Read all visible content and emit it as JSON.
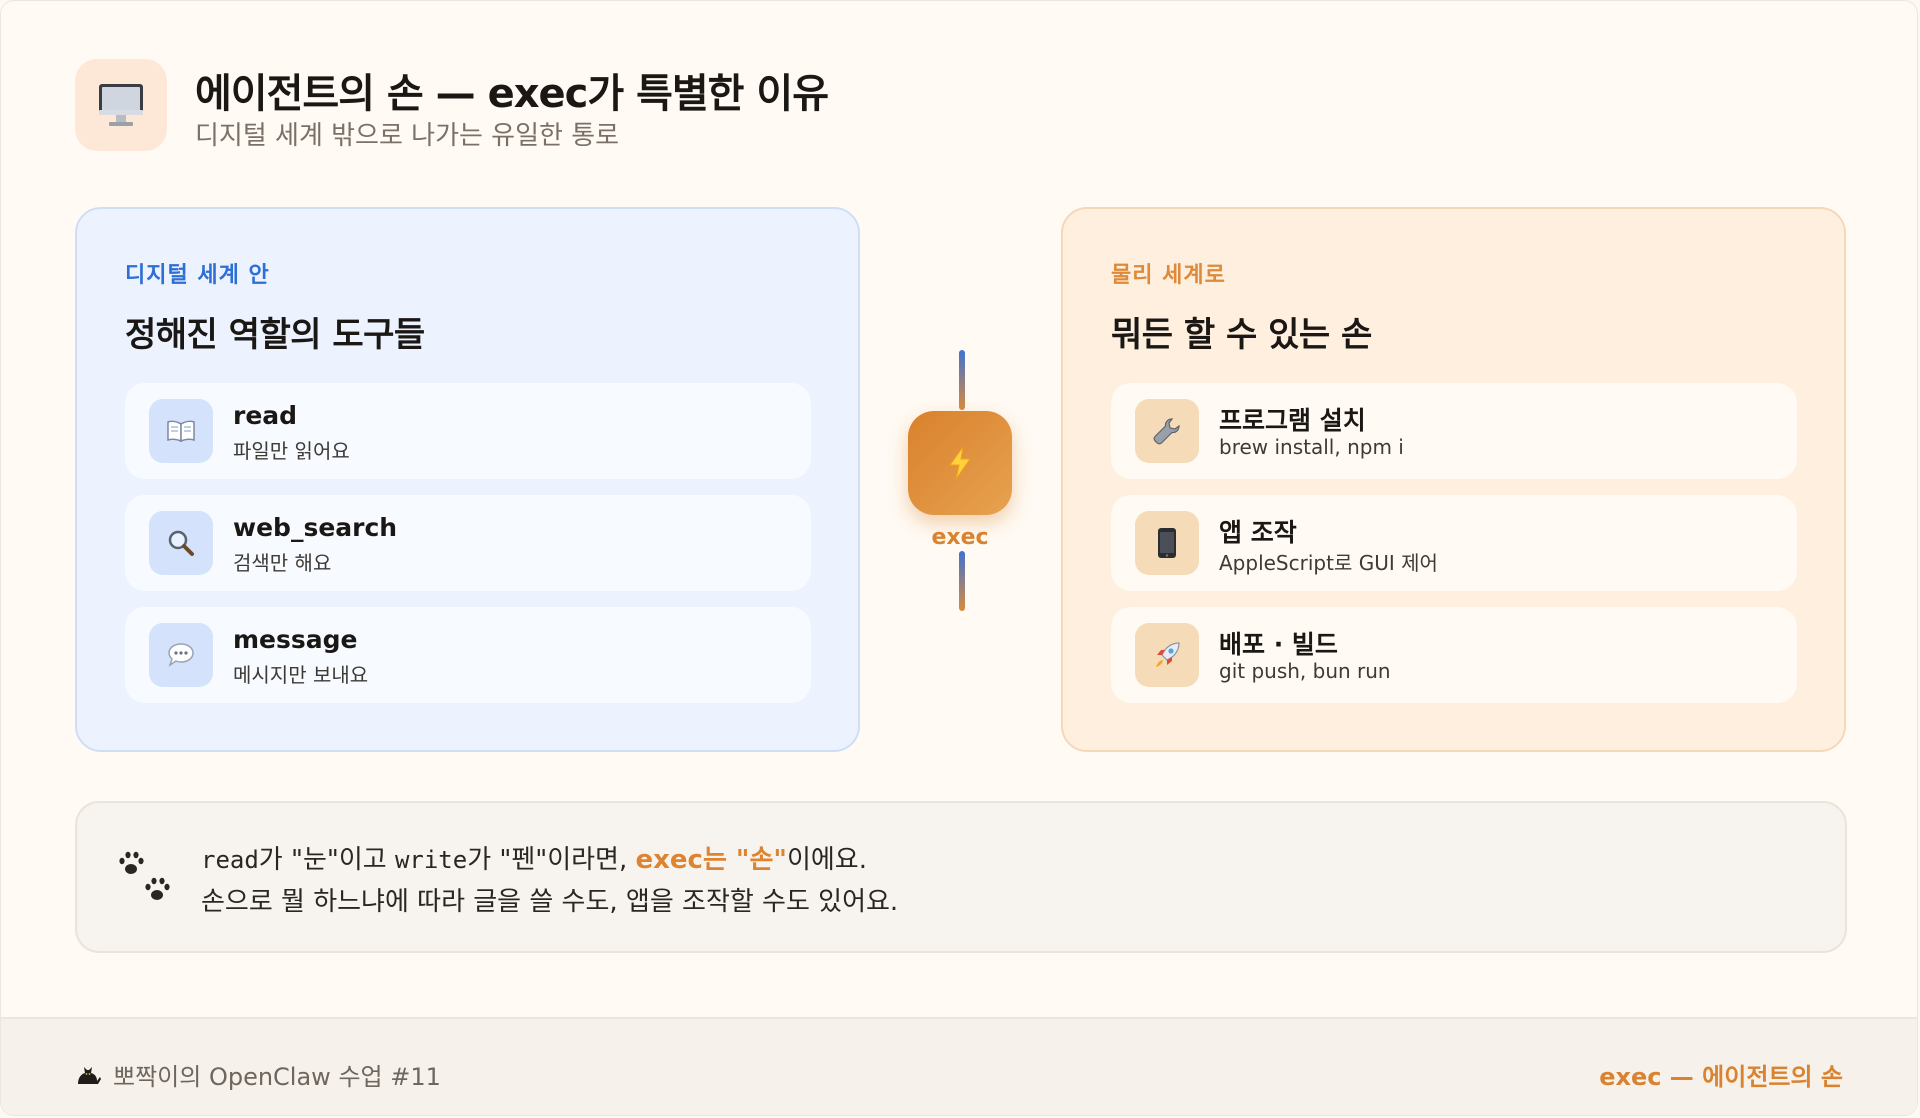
{
  "header": {
    "title": "에이전트의 손 — exec가 특별한 이유",
    "subtitle": "디지털 세계 밖으로 나가는 유일한 통로",
    "icon": "desktop-computer-icon"
  },
  "left_panel": {
    "kicker": "디지털 세계 안",
    "heading": "정해진 역할의 도구들",
    "items": [
      {
        "icon": "open-book-icon",
        "title": "read",
        "desc": "파일만 읽어요"
      },
      {
        "icon": "magnifier-icon",
        "title": "web_search",
        "desc": "검색만 해요"
      },
      {
        "icon": "speech-bubble-icon",
        "title": "message",
        "desc": "메시지만 보내요"
      }
    ]
  },
  "connector": {
    "icon": "lightning-bolt-icon",
    "label": "exec"
  },
  "right_panel": {
    "kicker": "물리 세계로",
    "heading": "뭐든 할 수 있는 손",
    "items": [
      {
        "icon": "wrench-icon",
        "title": "프로그램 설치",
        "desc": "brew install, npm i"
      },
      {
        "icon": "mobile-phone-icon",
        "title": "앱 조작",
        "desc": "AppleScript로 GUI 제어"
      },
      {
        "icon": "rocket-icon",
        "title": "배포 · 빌드",
        "desc": "git push, bun run"
      }
    ]
  },
  "note": {
    "icon": "paw-prints-icon",
    "line1": {
      "code1": "read",
      "text1": "가 \"눈\"이고 ",
      "code2": "write",
      "text2": "가 \"펜\"이라면, ",
      "highlight": "exec는 \"손\"",
      "text3": "이에요."
    },
    "line2": "손으로 뭘 하느냐에 따라 글을 쓸 수도, 앱을 조작할 수도 있어요."
  },
  "footer": {
    "icon": "black-cat-icon",
    "left_text": "뽀짝이의 OpenClaw 수업 #11",
    "right_text": "exec — 에이전트의 손"
  },
  "colors": {
    "accent_orange": "#de8431",
    "accent_blue": "#2e6fd6",
    "left_panel_bg": "#ecf3ff",
    "right_panel_bg": "#ffefdf"
  }
}
